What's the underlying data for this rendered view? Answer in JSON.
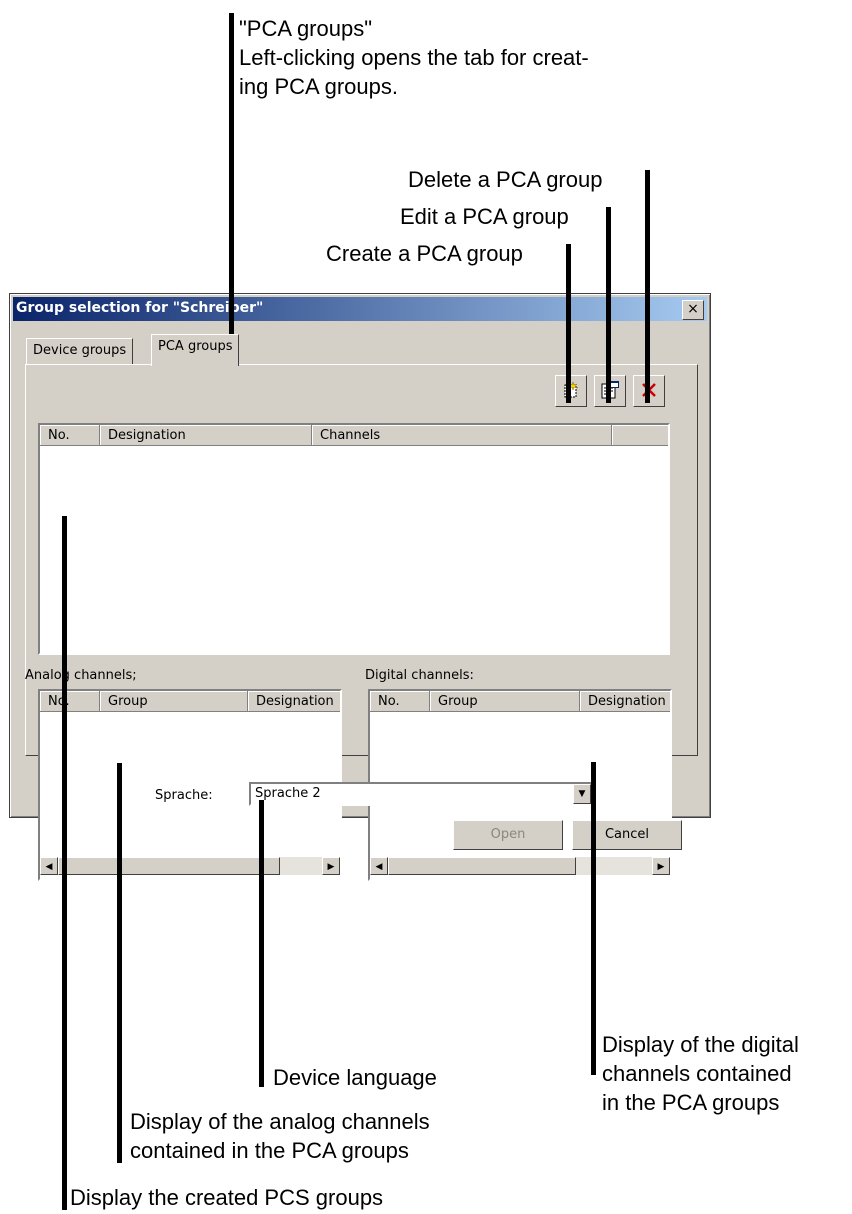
{
  "annotations": {
    "pca_tab_title": "\"PCA groups\"",
    "pca_tab_line1": "Left-clicking opens the tab for creat-",
    "pca_tab_line2": "ing PCA groups.",
    "delete": "Delete a PCA group",
    "edit": "Edit a PCA group",
    "create": "Create a PCA group",
    "digital_line1": "Display of the digital",
    "digital_line2": "channels contained",
    "digital_line3": "in the PCA groups",
    "language": "Device language",
    "analog_line1": "Display of the analog channels",
    "analog_line2": "contained in the PCA groups",
    "created": "Display the created PCS groups"
  },
  "dialog": {
    "title": "Group selection for \"Schreiber\"",
    "close_glyph": "×",
    "tabs": [
      "Device groups",
      "PCA groups"
    ],
    "active_tab": "PCA groups",
    "groups_list": {
      "columns": [
        "No.",
        "Designation",
        "Channels"
      ]
    },
    "analog": {
      "label": "Analog channels;",
      "columns": [
        "No.",
        "Group",
        "Designation"
      ]
    },
    "digital": {
      "label": "Digital channels:",
      "columns": [
        "No.",
        "Group",
        "Designation"
      ]
    },
    "language": {
      "label": "Sprache:",
      "value": "Sprache 2"
    },
    "buttons": {
      "open": "Open",
      "cancel": "Cancel"
    },
    "toolbar_icons": [
      "new-icon",
      "properties-icon",
      "delete-icon"
    ],
    "colors": {
      "title_start": "#0a246a",
      "title_end": "#a6caf0",
      "face": "#d4d0c8",
      "delete_icon": "#cc0000"
    }
  }
}
